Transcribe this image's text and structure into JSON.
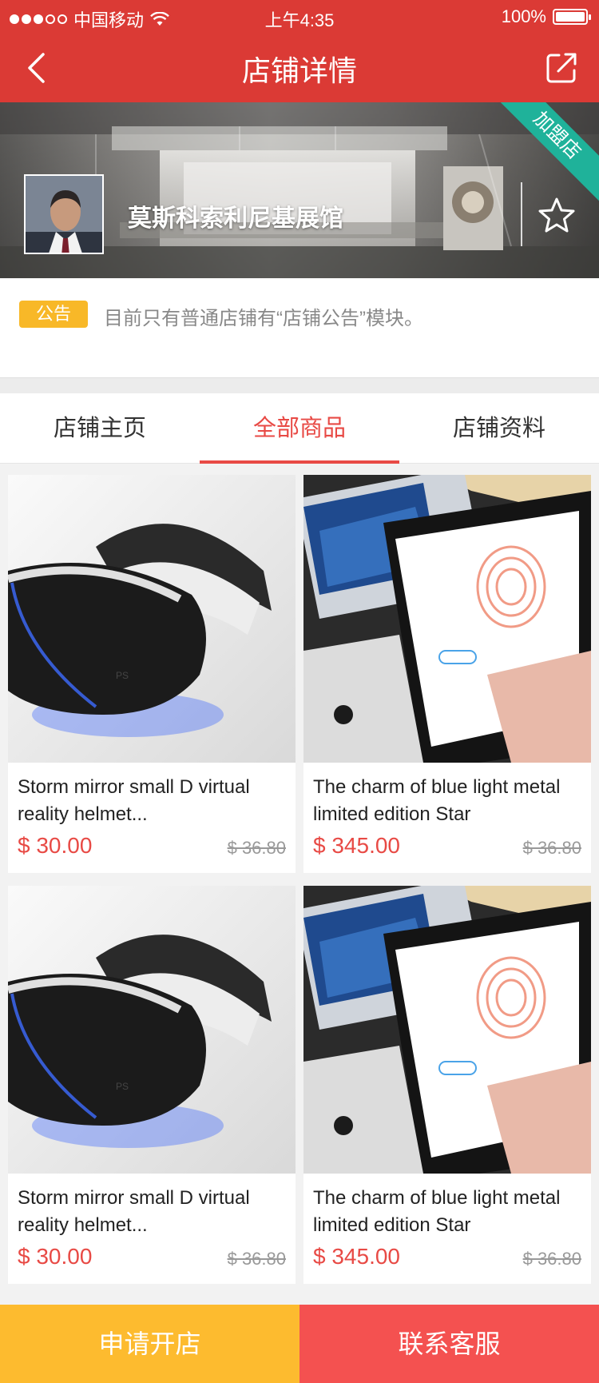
{
  "status_bar": {
    "carrier": "中国移动",
    "time": "上午4:35",
    "battery": "100%"
  },
  "nav": {
    "title": "店铺详情",
    "back_icon": "chevron-left-icon",
    "share_icon": "share-icon"
  },
  "shop": {
    "name": "莫斯科索利尼基展馆",
    "ribbon": "加盟店",
    "favorite_icon": "star-icon"
  },
  "notice": {
    "badge": "公告",
    "text": "目前只有普通店铺有“店铺公告”模块。"
  },
  "tabs": [
    {
      "label": "店铺主页",
      "active": false
    },
    {
      "label": "全部商品",
      "active": true
    },
    {
      "label": "店铺资料",
      "active": false
    }
  ],
  "products": [
    {
      "title": "Storm mirror small D virtual reality helmet...",
      "price": "$ 30.00",
      "old_price": "$ 36.80",
      "image": "vr-headset"
    },
    {
      "title": "The charm of blue light metal limited edition Star",
      "price": "$ 345.00",
      "old_price": "$ 36.80",
      "image": "smartphone"
    },
    {
      "title": "Storm mirror small D virtual reality helmet...",
      "price": "$ 30.00",
      "old_price": "$ 36.80",
      "image": "vr-headset"
    },
    {
      "title": "The charm of blue light metal limited edition Star",
      "price": "$ 345.00",
      "old_price": "$ 36.80",
      "image": "smartphone"
    }
  ],
  "bottom_bar": {
    "open_store": "申请开店",
    "contact_service": "联系客服"
  },
  "colors": {
    "header_red": "#db3a35",
    "accent_red": "#e84a45",
    "notice_yellow": "#f8b828",
    "ribbon_green": "#1fb29a",
    "open_store_yellow": "#fdbb2f",
    "service_red": "#f45150"
  }
}
